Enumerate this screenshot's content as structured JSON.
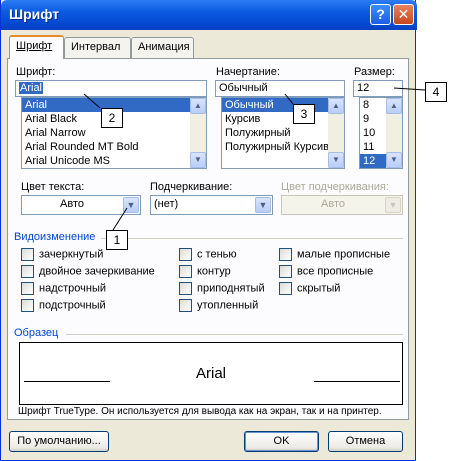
{
  "window": {
    "title": "Шрифт",
    "help_glyph": "?",
    "close_glyph": "✕"
  },
  "tabs": [
    {
      "label": "Шрифт",
      "active": true
    },
    {
      "label": "Интервал",
      "active": false
    },
    {
      "label": "Анимация",
      "active": false
    }
  ],
  "font": {
    "label": "Шрифт:",
    "value": "Arial",
    "items": [
      "Arial",
      "Arial Black",
      "Arial Narrow",
      "Arial Rounded MT Bold",
      "Arial Unicode MS"
    ],
    "selected_index": 0
  },
  "style": {
    "label": "Начертание:",
    "value": "Обычный",
    "items": [
      "Обычный",
      "Курсив",
      "Полужирный",
      "Полужирный Курсив"
    ],
    "selected_index": 0
  },
  "size": {
    "label": "Размер:",
    "value": "12",
    "items": [
      "8",
      "9",
      "10",
      "11",
      "12"
    ],
    "selected_index": 4
  },
  "text_color": {
    "label": "Цвет текста:",
    "value": "Авто"
  },
  "underline": {
    "label": "Подчеркивание:",
    "value": "(нет)"
  },
  "underline_color": {
    "label": "Цвет подчеркивания:",
    "value": "Авто"
  },
  "effects": {
    "title": "Видоизменение",
    "items": [
      "зачеркнутый",
      "двойное зачеркивание",
      "надстрочный",
      "подстрочный",
      "с тенью",
      "контур",
      "приподнятый",
      "утопленный",
      "малые прописные",
      "все прописные",
      "скрытый"
    ]
  },
  "preview": {
    "title": "Образец",
    "sample": "Arial",
    "note": "Шрифт TrueType. Он используется для вывода как на экран, так и на принтер."
  },
  "buttons": {
    "default": "По умолчанию...",
    "ok": "OK",
    "cancel": "Отмена"
  },
  "callouts": [
    "1",
    "2",
    "3",
    "4"
  ],
  "colors": {
    "titlebar": "#0a5be0",
    "dialog_bg": "#ece9d8",
    "selection": "#316ac5",
    "group_title": "#0046d5"
  }
}
